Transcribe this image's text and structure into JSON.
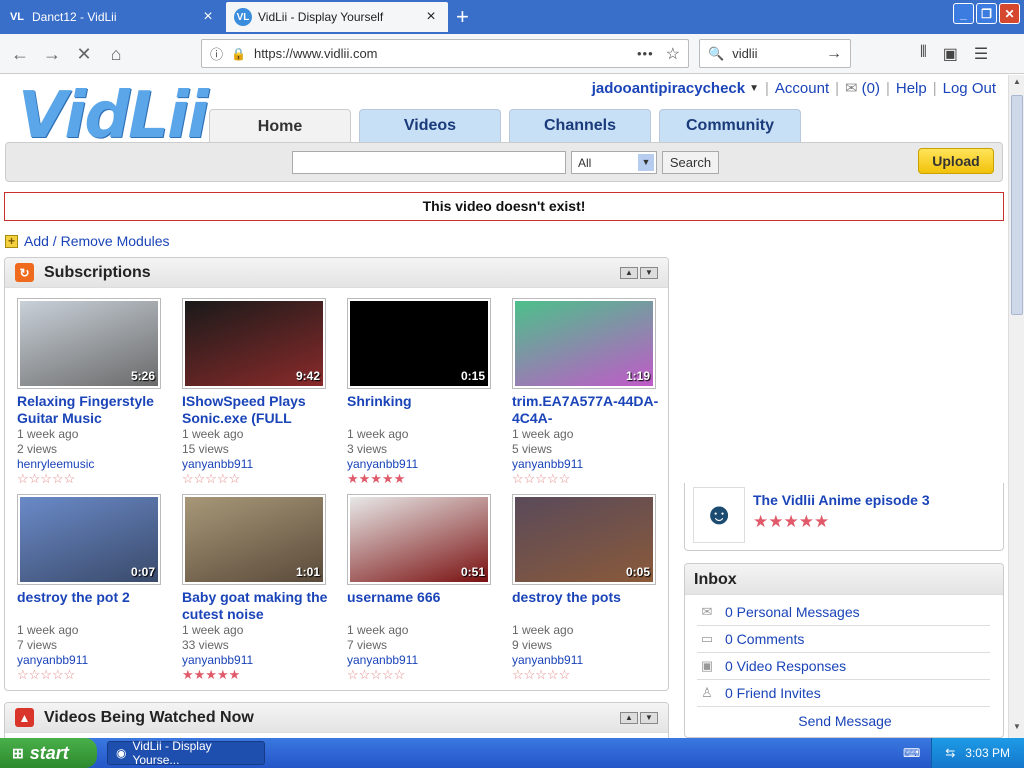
{
  "browser": {
    "tabs": [
      {
        "favicon": "VL",
        "title": "Danct12 - VidLii",
        "close": "×"
      },
      {
        "favicon": "VL",
        "title": "VidLii - Display Yourself",
        "close": "×"
      }
    ],
    "new_tab": "+",
    "url": "https://www.vidlii.com",
    "search_query": "vidlii"
  },
  "site": {
    "logo": "VidLii",
    "username": "jadooantipiracycheck",
    "account": "Account",
    "inbox_count": "(0)",
    "help": "Help",
    "logout": "Log Out",
    "nav_tabs": [
      "Home",
      "Videos",
      "Channels",
      "Community"
    ],
    "search_value": "",
    "search_scope": "All",
    "search_button": "Search",
    "upload_button": "Upload",
    "error_message": "This video doesn't exist!",
    "add_modules": "Add / Remove Modules"
  },
  "subscriptions": {
    "title": "Subscriptions",
    "videos": [
      {
        "title": "Relaxing Fingerstyle Guitar Music",
        "duration": "5:26",
        "age": "1 week ago",
        "views": "2 views",
        "user": "henryleemusic",
        "rating": 0,
        "colors": [
          "#c8d0d8",
          "#6a6a6a"
        ]
      },
      {
        "title": "IShowSpeed Plays Sonic.exe (FULL",
        "duration": "9:42",
        "age": "1 week ago",
        "views": "15 views",
        "user": "yanyanbb911",
        "rating": 0,
        "colors": [
          "#1a1a1a",
          "#8a2a2a"
        ]
      },
      {
        "title": "Shrinking",
        "duration": "0:15",
        "age": "1 week ago",
        "views": "3 views",
        "user": "yanyanbb911",
        "rating": 5,
        "colors": [
          "#000000",
          "#000000"
        ]
      },
      {
        "title": "trim.EA7A577A-44DA-4C4A-",
        "duration": "1:19",
        "age": "1 week ago",
        "views": "5 views",
        "user": "yanyanbb911",
        "rating": 0,
        "colors": [
          "#4cc08a",
          "#c05ac8"
        ]
      },
      {
        "title": "destroy the pot 2",
        "duration": "0:07",
        "age": "1 week ago",
        "views": "7 views",
        "user": "yanyanbb911",
        "rating": 0,
        "colors": [
          "#6a8ac8",
          "#3a4a6a"
        ]
      },
      {
        "title": "Baby goat making the cutest noise",
        "duration": "1:01",
        "age": "1 week ago",
        "views": "33 views",
        "user": "yanyanbb911",
        "rating": 5,
        "colors": [
          "#a89878",
          "#5a4a3a"
        ]
      },
      {
        "title": "username 666",
        "duration": "0:51",
        "age": "1 week ago",
        "views": "7 views",
        "user": "yanyanbb911",
        "rating": 0,
        "colors": [
          "#e8e8e8",
          "#7a1010"
        ]
      },
      {
        "title": "destroy the pots",
        "duration": "0:05",
        "age": "1 week ago",
        "views": "9 views",
        "user": "yanyanbb911",
        "rating": 0,
        "colors": [
          "#5a4a5a",
          "#8a5a3a"
        ]
      }
    ]
  },
  "watching_now": {
    "title": "Videos Being Watched Now"
  },
  "featured": {
    "title": "The Vidlii Anime episode 3",
    "rating": 5
  },
  "inbox": {
    "title": "Inbox",
    "items": [
      {
        "icon": "envelope-icon",
        "label": "0 Personal Messages"
      },
      {
        "icon": "comment-icon",
        "label": "0 Comments"
      },
      {
        "icon": "video-response-icon",
        "label": "0 Video Responses"
      },
      {
        "icon": "friend-icon",
        "label": "0 Friend Invites"
      }
    ],
    "send": "Send Message"
  },
  "taskbar": {
    "start": "start",
    "item": "VidLii - Display Yourse...",
    "time": "3:03 PM"
  }
}
